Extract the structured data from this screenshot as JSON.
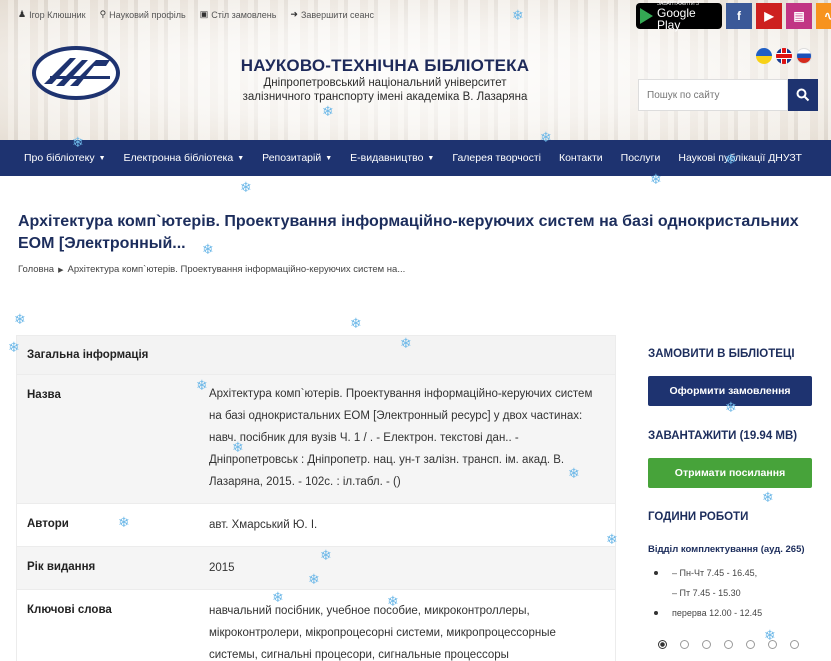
{
  "toplinks": [
    {
      "icon": "user-icon",
      "label": "Ігор Клюшник"
    },
    {
      "icon": "search-icon",
      "label": "Науковий профіль"
    },
    {
      "icon": "cart-icon",
      "label": "Стіл замовлень"
    },
    {
      "icon": "logout-icon",
      "label": "Завершити сеанс"
    }
  ],
  "store": {
    "small": "ЗАВАНТАЖИТИ З",
    "big": "Google Play"
  },
  "social": [
    {
      "icon": "facebook-icon",
      "glyph": "f",
      "color": "#3b5998"
    },
    {
      "icon": "youtube-icon",
      "glyph": "▶",
      "color": "#cd201f"
    },
    {
      "icon": "instagram-icon",
      "glyph": "◘",
      "color": "#c13584"
    },
    {
      "icon": "rss-icon",
      "glyph": "◉",
      "color": "#f7931e"
    }
  ],
  "library": {
    "title": "НАУКОВО-ТЕХНІЧНА БІБЛІОТЕКА",
    "sub1": "Дніпропетровський національний університет",
    "sub2": "залізничного транспорту імені академіка В. Лазаряна"
  },
  "search": {
    "placeholder": "Пошук по сайту"
  },
  "nav": [
    {
      "label": "Про бібліотеку",
      "caret": true
    },
    {
      "label": "Електронна бібліотека",
      "caret": true
    },
    {
      "label": "Репозитарій",
      "caret": true
    },
    {
      "label": "Е-видавництво",
      "caret": true
    },
    {
      "label": "Галерея творчості",
      "caret": false
    },
    {
      "label": "Контакти",
      "caret": false
    },
    {
      "label": "Послуги",
      "caret": false
    },
    {
      "label": "Наукові публікації ДНУЗТ",
      "caret": false
    }
  ],
  "page": {
    "title": "Архітектура комп`ютерів. Проектування інформаційно-керуючих систем на базі однокристальних ЕОМ [Электронный...",
    "breadcrumb_home": "Головна",
    "breadcrumb_current": "Архітектура комп`ютерів. Проектування інформаційно-керуючих систем на..."
  },
  "info": {
    "header": "Загальна інформація",
    "rows": [
      {
        "key": "Назва",
        "value": "Архітектура комп`ютерів. Проектування інформаційно-керуючих систем на базі однокристальних ЕОМ [Электронный ресурс] у двох частинах: навч. посібник для вузів Ч. 1 / . - Електрон. текстові дан.. - Дніпропетровськ : Дніпропетр. нац. ун-т залізн. трансп. ім. акад. В. Лазаряна, 2015. - 102с. : іл.табл. - ()"
      },
      {
        "key": "Автори",
        "value": "авт. Хмарський Ю. І."
      },
      {
        "key": "Рік видання",
        "value": "2015"
      },
      {
        "key": "Ключові слова",
        "value": "навчальний посібник, учебное пособие, микроконтроллеры, мікроконтролери, мікропроцесорні системи, микропроцессорные системы, сигнальні процесори, сигнальные процессоры"
      }
    ]
  },
  "sidebar": {
    "order_heading": "ЗАМОВИТИ В БІБЛІОТЕЦІ",
    "order_button": "Оформити замовлення",
    "download_heading": "ЗАВАНТАЖИТИ (19.94 MB)",
    "download_button": "Отримати посилання",
    "hours_heading": "ГОДИНИ РОБОТИ",
    "hours_dept": "Відділ комплектування (ауд. 265)",
    "hours": [
      {
        "text": "– Пн-Чт 7.45 - 16.45,",
        "bullet": true
      },
      {
        "text": "– Пт 7.45 - 15.30",
        "bullet": false
      },
      {
        "text": "перерва 12.00 - 12.45",
        "bullet": true
      }
    ],
    "carousel_active": 1,
    "carousel_count": 7
  },
  "colors": {
    "brand": "#1e3370",
    "green": "#47a33a",
    "snow": "#6db8e8"
  }
}
